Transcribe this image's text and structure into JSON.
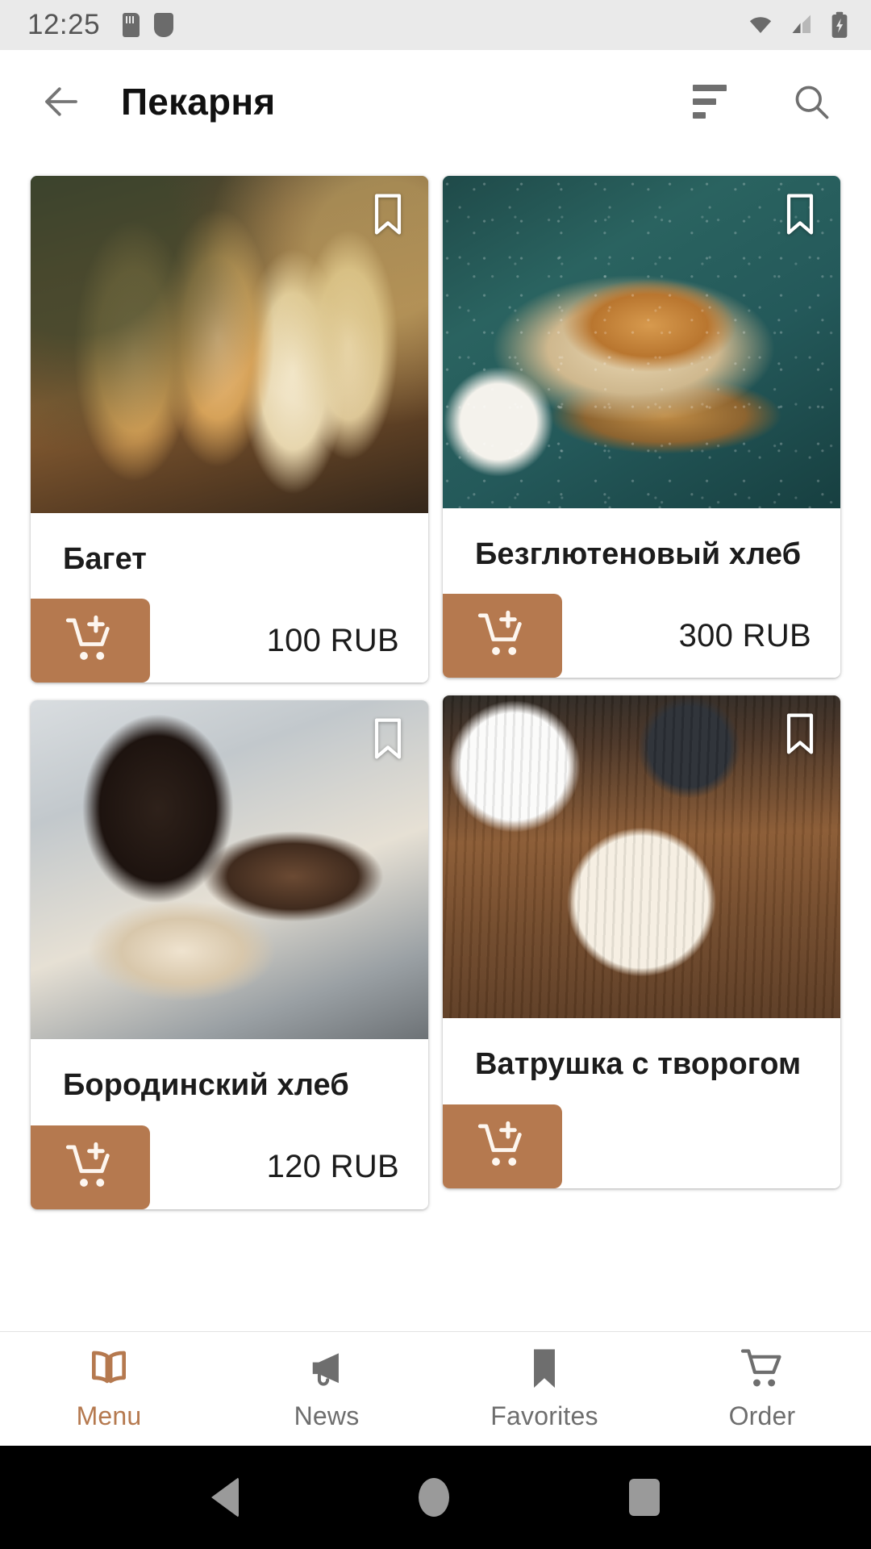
{
  "status_bar": {
    "time": "12:25",
    "left_icons": [
      "sd-card-icon",
      "shield-icon"
    ],
    "right_icons": [
      "wifi-icon",
      "cellular-signal-icon",
      "battery-charging-icon"
    ]
  },
  "app_bar": {
    "back_icon": "back-arrow-icon",
    "title": "Пекарня",
    "sort_icon": "sort-icon",
    "search_icon": "search-icon"
  },
  "theme": {
    "accent": "#b5794f",
    "accent_text": "#b5794f",
    "background": "#ffffff",
    "title_color": "#111111",
    "status_bar_bg": "#eaeaea",
    "inactive_nav": "#6e6e6e"
  },
  "products": [
    {
      "id": "baguette",
      "name": "Багет",
      "price": "100 RUB",
      "bookmark_icon": "bookmark-icon",
      "bookmarked": false,
      "add_icon": "add-to-cart-icon",
      "image_alt": "baguettes-on-wooden-board"
    },
    {
      "id": "gluten-free-bread",
      "name": "Безглютеновый хлеб",
      "price": "300 RUB",
      "bookmark_icon": "bookmark-icon",
      "bookmarked": false,
      "add_icon": "add-to-cart-icon",
      "image_alt": "gluten-free-loaf-on-teal-table"
    },
    {
      "id": "borodinsky-bread",
      "name": "Бородинский хлеб",
      "price": "120 RUB",
      "bookmark_icon": "bookmark-icon",
      "bookmarked": false,
      "add_icon": "add-to-cart-icon",
      "image_alt": "sliced-dark-rye-bread"
    },
    {
      "id": "vatrushka-cottage-cheese",
      "name": "Ватрушка с творогом",
      "price": "",
      "bookmark_icon": "bookmark-icon",
      "bookmarked": false,
      "add_icon": "add-to-cart-icon",
      "image_alt": "vatrushka-pastry-with-tea"
    }
  ],
  "bottom_nav": {
    "items": [
      {
        "label": "Menu",
        "icon": "book-icon",
        "active": true
      },
      {
        "label": "News",
        "icon": "megaphone-icon",
        "active": false
      },
      {
        "label": "Favorites",
        "icon": "bookmark-icon",
        "active": false
      },
      {
        "label": "Order",
        "icon": "cart-icon",
        "active": false
      }
    ]
  },
  "android_nav": {
    "back": "android-back-icon",
    "home": "android-home-icon",
    "recents": "android-recents-icon"
  }
}
